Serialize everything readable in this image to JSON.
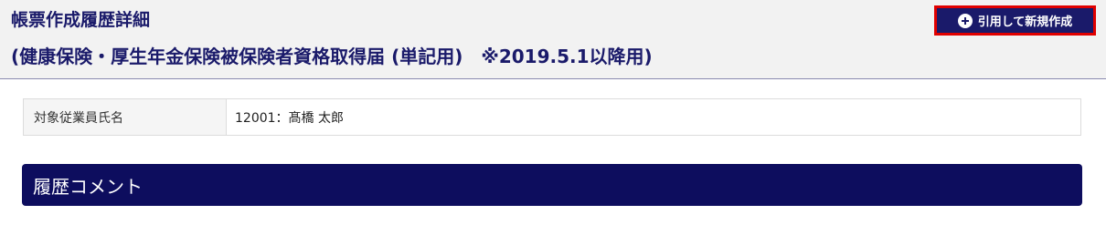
{
  "header": {
    "title": "帳票作成履歴詳細",
    "subtitle": "(健康保険・厚生年金保険被保険者資格取得届 (単記用)　※2019.5.1以降用)",
    "copy_button": {
      "label": "引用して新規作成",
      "icon": "plus-circle-icon"
    }
  },
  "employee": {
    "label": "対象従業員氏名",
    "value": "12001：髙橋 太郎"
  },
  "history_comment": {
    "title": "履歴コメント"
  },
  "colors": {
    "accent": "#1a1a6a",
    "section_header": "#0d0d5e",
    "highlight_border": "#e00000"
  }
}
